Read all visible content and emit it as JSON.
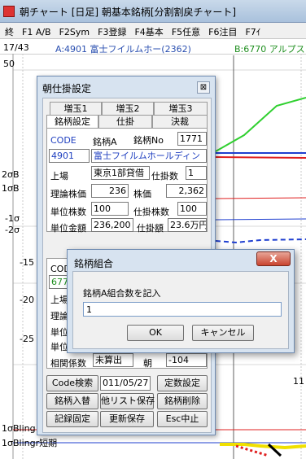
{
  "app": {
    "title": "朝チャート  [日足]  朝基本銘柄[分割割戻チャート]"
  },
  "menu": [
    "終",
    "F1 A/B",
    "F2Sym",
    "F3登録",
    "F4基本",
    "F5任意",
    "F6注目",
    "F7ｲ"
  ],
  "chart": {
    "pager": "17/43",
    "stock_a": "A:4901 富士フイルムホー(2362)",
    "stock_b": "B:6770 アルプス",
    "left_labels": [
      "50",
      "2σB",
      "1σB",
      "-1σ",
      "-2σ",
      "-15",
      "-20",
      "-25"
    ],
    "bottom_labels": [
      "1σBling",
      "1σBlingr短期"
    ],
    "right_label": "11"
  },
  "settings": {
    "title": "朝仕掛設定",
    "close": "⊠",
    "tabs_top": [
      "増玉1",
      "増玉2",
      "増玉3"
    ],
    "tabs_bottom": [
      "銘柄設定",
      "仕掛",
      "決裁"
    ],
    "code_label": "CODE",
    "meigara_a_label": "銘柄A",
    "meigara_no_label": "銘柄No",
    "meigara_no": "1771",
    "code_a": "4901",
    "name_a": "富士フイルムホールディン",
    "jojo_label": "上場",
    "market_a": "東京1部貸借",
    "shikake_count_label": "仕掛数",
    "shikake_count": "1",
    "riron_label": "理論株価",
    "riron": "236",
    "kabuka_label": "株価",
    "kabuka": "2,362",
    "tani_label": "単位株数",
    "tani": "100",
    "shikake_kabusu_label": "仕掛株数",
    "shikake_kabusu": "100",
    "tani_kingaku_label": "単位金額",
    "tani_kingaku": "236,200",
    "shikake_gaku_label": "仕掛額",
    "shikake_gaku": "23.6万円",
    "code_label_b": "COD",
    "code_b": "6770",
    "jojo_label_b": "上場",
    "riron_label_b": "理論",
    "tani_label_b": "単位",
    "tani2_label_b": "単位",
    "sokan_label": "相関係数",
    "sokan_value": "未算出",
    "asa_label": "朝",
    "asa_value": "-104",
    "btn_code_search": "Code検索",
    "date_value": "011/05/27",
    "btn_teisu": "定数設定",
    "btn_meigara_nyukae": "銘柄入替",
    "btn_ta_list": "他リスト保存",
    "btn_meigara_sakujo": "銘柄削除",
    "btn_kiroku": "記録固定",
    "btn_koshin": "更新保存",
    "btn_esc": "Esc中止"
  },
  "combo_dialog": {
    "title": "銘柄組合",
    "close": "X",
    "prompt": "銘柄A組合数を記入",
    "input_value": "1",
    "ok": "OK",
    "cancel": "キャンセル"
  },
  "colors": {
    "chart_red": "#e02020",
    "chart_blue": "#1f3fd0",
    "chart_green": "#30d030",
    "chart_yellow": "#f0e000"
  }
}
